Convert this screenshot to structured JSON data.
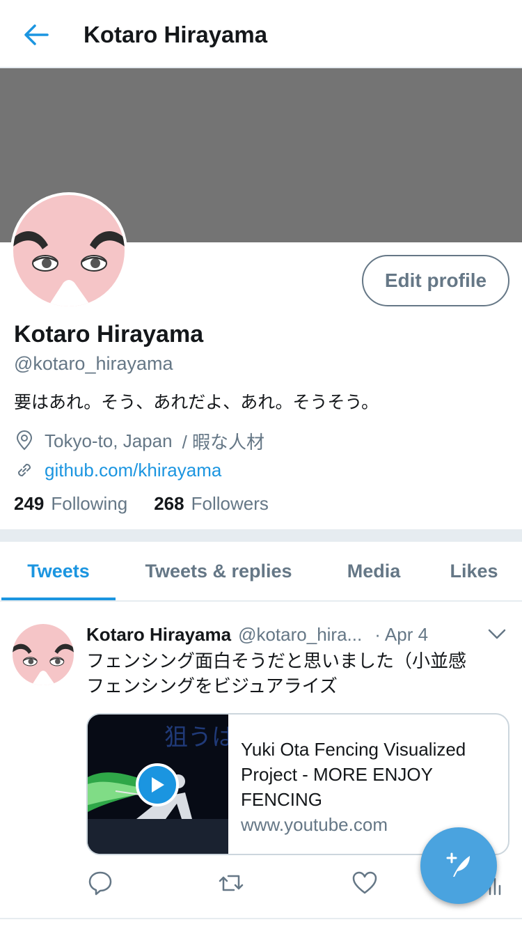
{
  "header": {
    "title": "Kotaro Hirayama"
  },
  "profile": {
    "edit_label": "Edit profile",
    "name": "Kotaro Hirayama",
    "handle": "@kotaro_hirayama",
    "bio": "要はあれ。そう、あれだよ、あれ。そうそう。",
    "location": "Tokyo-to, Japan",
    "location_extra": "/ 暇な人材",
    "link": "github.com/khirayama",
    "following_count": "249",
    "following_label": "Following",
    "followers_count": "268",
    "followers_label": "Followers"
  },
  "tabs": [
    {
      "label": "Tweets",
      "active": true
    },
    {
      "label": "Tweets & replies",
      "active": false
    },
    {
      "label": "Media",
      "active": false
    },
    {
      "label": "Likes",
      "active": false
    }
  ],
  "tweet": {
    "name": "Kotaro Hirayama",
    "handle": "@kotaro_hira...",
    "dot": "·",
    "date": "Apr 4",
    "text_line1": "フェンシング面白そうだと思いました（小並感",
    "text_line2": "フェンシングをビジュアライズ",
    "card": {
      "title": "Yuki Ota Fencing Visualized Project - MORE ENJOY FENCING",
      "domain": "www.youtube.com",
      "thumb_text": "狙うは"
    }
  },
  "colors": {
    "accent": "#1b95e0",
    "banner": "#747474",
    "muted": "#657786",
    "fab": "#4aa3df"
  },
  "icons": [
    "back-arrow-icon",
    "location-icon",
    "link-icon",
    "chevron-down-icon",
    "play-icon",
    "reply-icon",
    "retweet-icon",
    "like-icon",
    "compose-icon"
  ]
}
